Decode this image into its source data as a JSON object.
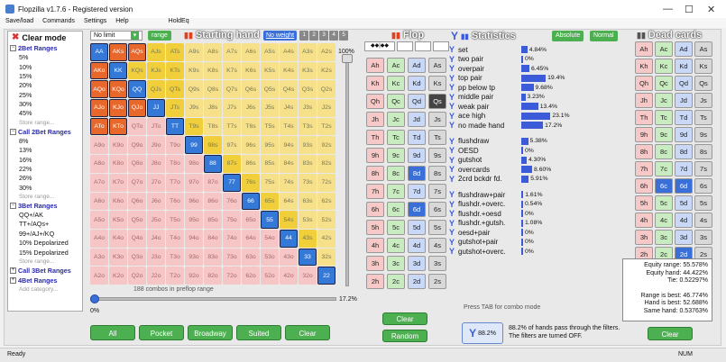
{
  "app": {
    "title": "Flopzilla v1.7.6 - Registered version",
    "minimize": "—",
    "maximize": "☐",
    "close": "✕"
  },
  "menu": [
    "Save/load",
    "Commands",
    "Settings",
    "Help",
    "HoldEq"
  ],
  "sidebar": {
    "header": "Clear mode",
    "groups": [
      {
        "title": "2Bet Ranges",
        "items": [
          "5%",
          "10%",
          "15%",
          "20%",
          "25%",
          "30%",
          "45%"
        ],
        "store": "Store range..."
      },
      {
        "title": "Call 2Bet Ranges",
        "items": [
          "8%",
          "13%",
          "16%",
          "22%",
          "26%",
          "30%"
        ],
        "store": "Store range..."
      },
      {
        "title": "3Bet Ranges",
        "items": [
          "QQ+/AK",
          "TT+/AQs+",
          "99+/AJ+/KQ",
          "10% Depolarized",
          "15% Depolarized"
        ],
        "store": "Store range..."
      },
      {
        "title": "Call 3Bet Ranges",
        "items": [],
        "store": ""
      },
      {
        "title": "4Bet Ranges",
        "items": [],
        "store": "Add category..."
      }
    ]
  },
  "toolbar": {
    "limit": "No limit",
    "range_btn": "range",
    "startinghand_title": "Starting hand",
    "weight_btn": "No weight",
    "slots": [
      "1",
      "2",
      "3",
      "4",
      "5"
    ]
  },
  "grid": [
    [
      "AA",
      "AKs",
      "AQs",
      "AJs",
      "ATs",
      "A9s",
      "A8s",
      "A7s",
      "A6s",
      "A5s",
      "A4s",
      "A3s",
      "A2s"
    ],
    [
      "AKo",
      "KK",
      "KQs",
      "KJs",
      "KTs",
      "K9s",
      "K8s",
      "K7s",
      "K6s",
      "K5s",
      "K4s",
      "K3s",
      "K2s"
    ],
    [
      "AQo",
      "KQo",
      "QQ",
      "QJs",
      "QTs",
      "Q9s",
      "Q8s",
      "Q7s",
      "Q6s",
      "Q5s",
      "Q4s",
      "Q3s",
      "Q2s"
    ],
    [
      "AJo",
      "KJo",
      "QJo",
      "JJ",
      "JTs",
      "J9s",
      "J8s",
      "J7s",
      "J6s",
      "J5s",
      "J4s",
      "J3s",
      "J2s"
    ],
    [
      "ATo",
      "KTo",
      "QTo",
      "JTo",
      "TT",
      "T9s",
      "T8s",
      "T7s",
      "T6s",
      "T5s",
      "T4s",
      "T3s",
      "T2s"
    ],
    [
      "A9o",
      "K9o",
      "Q9o",
      "J9o",
      "T9o",
      "99",
      "98s",
      "97s",
      "96s",
      "95s",
      "94s",
      "93s",
      "92s"
    ],
    [
      "A8o",
      "K8o",
      "Q8o",
      "J8o",
      "T8o",
      "98o",
      "88",
      "87s",
      "86s",
      "85s",
      "84s",
      "83s",
      "82s"
    ],
    [
      "A7o",
      "K7o",
      "Q7o",
      "J7o",
      "T7o",
      "97o",
      "87o",
      "77",
      "76s",
      "75s",
      "74s",
      "73s",
      "72s"
    ],
    [
      "A6o",
      "K6o",
      "Q6o",
      "J6o",
      "T6o",
      "96o",
      "86o",
      "76o",
      "66",
      "65s",
      "64s",
      "63s",
      "62s"
    ],
    [
      "A5o",
      "K5o",
      "Q5o",
      "J5o",
      "T5o",
      "95o",
      "85o",
      "75o",
      "65o",
      "55",
      "54s",
      "53s",
      "52s"
    ],
    [
      "A4o",
      "K4o",
      "Q4o",
      "J4o",
      "T4o",
      "94o",
      "84o",
      "74o",
      "64o",
      "54o",
      "44",
      "43s",
      "42s"
    ],
    [
      "A3o",
      "K3o",
      "Q3o",
      "J3o",
      "T3o",
      "93o",
      "83o",
      "73o",
      "63o",
      "53o",
      "43o",
      "33",
      "32s"
    ],
    [
      "A2o",
      "K2o",
      "Q2o",
      "J2o",
      "T2o",
      "92o",
      "82o",
      "72o",
      "62o",
      "52o",
      "42o",
      "32o",
      "22"
    ]
  ],
  "grid_colors": {
    "orange": "#e8672a",
    "blue": "#3478d8",
    "yellow": "#f7e08a",
    "yellow_dark": "#f1cf3a",
    "pink": "#f6c6c6",
    "olive": "#d6d07a"
  },
  "range": {
    "pct": "100%",
    "bottom_pct": "17.2%",
    "combos": "188 combos in preflop range",
    "zero": "0%"
  },
  "range_buttons": [
    "All",
    "Pocket",
    "Broadway",
    "Suited",
    "Clear"
  ],
  "flop": {
    "title": "Flop",
    "cards": [
      [
        "Ah",
        "Ac",
        "Ad",
        "As"
      ],
      [
        "Kh",
        "Kc",
        "Kd",
        "Ks"
      ],
      [
        "Qh",
        "Qc",
        "Qd",
        "Qs"
      ],
      [
        "Jh",
        "Jc",
        "Jd",
        "Js"
      ],
      [
        "Th",
        "Tc",
        "Td",
        "Ts"
      ],
      [
        "9h",
        "9c",
        "9d",
        "9s"
      ],
      [
        "8h",
        "8c",
        "8d",
        "8s"
      ],
      [
        "7h",
        "7c",
        "7d",
        "7s"
      ],
      [
        "6h",
        "6c",
        "6d",
        "6s"
      ],
      [
        "5h",
        "5c",
        "5d",
        "5s"
      ],
      [
        "4h",
        "4c",
        "4d",
        "4s"
      ],
      [
        "3h",
        "3c",
        "3d",
        "3s"
      ],
      [
        "2h",
        "2c",
        "2d",
        "2s"
      ]
    ],
    "clear": "Clear",
    "random": "Random"
  },
  "statistics": {
    "title": "Statistics",
    "absolute": "Absolute",
    "normal": "Normal",
    "rows": [
      {
        "label": "set",
        "pct": "4.84%",
        "v": 4.84
      },
      {
        "label": "two pair",
        "pct": "0%",
        "v": 0
      },
      {
        "label": "overpair",
        "pct": "6.45%",
        "v": 6.45
      },
      {
        "label": "top pair",
        "pct": "19.4%",
        "v": 19.4
      },
      {
        "label": "pp below tp",
        "pct": "9.68%",
        "v": 9.68
      },
      {
        "label": "middle pair",
        "pct": "3.23%",
        "v": 3.23
      },
      {
        "label": "weak pair",
        "pct": "13.4%",
        "v": 13.4
      },
      {
        "label": "ace high",
        "pct": "23.1%",
        "v": 23.1
      },
      {
        "label": "no made hand",
        "pct": "17.2%",
        "v": 17.2
      }
    ],
    "rows2": [
      {
        "label": "flushdraw",
        "pct": "5.38%",
        "v": 5.38
      },
      {
        "label": "OESD",
        "pct": "0%",
        "v": 0
      },
      {
        "label": "gutshot",
        "pct": "4.30%",
        "v": 4.3
      },
      {
        "label": "overcards",
        "pct": "8.60%",
        "v": 8.6
      },
      {
        "label": "2crd bckdr fd.",
        "pct": "5.91%",
        "v": 5.91
      }
    ],
    "rows3": [
      {
        "label": "flushdraw+pair",
        "pct": "1.61%",
        "v": 1.61
      },
      {
        "label": "flushdr.+overc.",
        "pct": "0.54%",
        "v": 0.54
      },
      {
        "label": "flushdr.+oesd",
        "pct": "0%",
        "v": 0
      },
      {
        "label": "flushdr.+gutsh.",
        "pct": "1.08%",
        "v": 1.08
      },
      {
        "label": "oesd+pair",
        "pct": "0%",
        "v": 0
      },
      {
        "label": "gutshot+pair",
        "pct": "0%",
        "v": 0
      },
      {
        "label": "gutshot+overc.",
        "pct": "0%",
        "v": 0
      }
    ],
    "tab_note": "Press TAB for combo mode",
    "filter_pct": "88.2%",
    "filter_note": "88.2% of hands pass through the filters. The filters are turned OFF."
  },
  "dead": {
    "title": "Dead cards",
    "cards": [
      [
        "Ah",
        "Ac",
        "Ad",
        "As"
      ],
      [
        "Kh",
        "Kc",
        "Kd",
        "Ks"
      ],
      [
        "Qh",
        "Qc",
        "Qd",
        "Qs"
      ],
      [
        "Jh",
        "Jc",
        "Jd",
        "Js"
      ],
      [
        "Th",
        "Tc",
        "Td",
        "Ts"
      ],
      [
        "9h",
        "9c",
        "9d",
        "9s"
      ],
      [
        "8h",
        "8c",
        "8d",
        "8s"
      ],
      [
        "7h",
        "7c",
        "7d",
        "7s"
      ],
      [
        "6h",
        "6c",
        "6d",
        "6s"
      ],
      [
        "5h",
        "5c",
        "5d",
        "5s"
      ],
      [
        "4h",
        "4c",
        "4d",
        "4s"
      ],
      [
        "3h",
        "3c",
        "3d",
        "3s"
      ],
      [
        "2h",
        "2c",
        "2d",
        "2s"
      ]
    ],
    "clear": "Clear"
  },
  "equity": [
    "Equity range: 55.578%",
    "Equity hand: 44.422%",
    "Tie: 0.52297%",
    "",
    "Range is best: 46.774%",
    "Hand is best: 52.688%",
    "Same hand: 0.53763%"
  ],
  "status": {
    "left": "Ready",
    "right": "NUM"
  }
}
